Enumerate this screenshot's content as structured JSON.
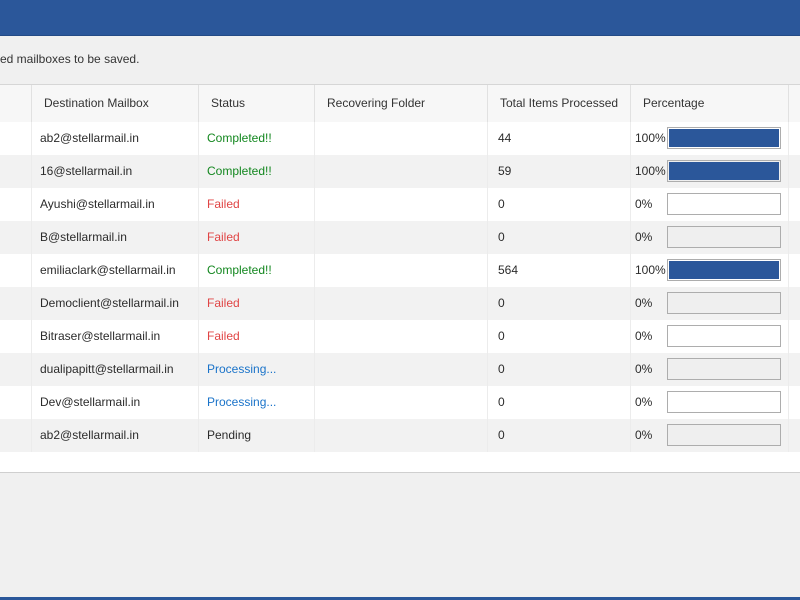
{
  "info_text": "ed mailboxes to be saved.",
  "colors": {
    "titlebar": "#2b579a",
    "completed": "#13871f",
    "failed": "#e04545",
    "processing": "#1a73c9",
    "pending": "#2b2b2b",
    "progress_fill": "#2b579a"
  },
  "columns": [
    "Destination Mailbox",
    "Status",
    "Recovering Folder",
    "Total Items Processed",
    "Percentage"
  ],
  "rows": [
    {
      "mailbox": "ab2@stellarmail.in",
      "status": "Completed!!",
      "status_kind": "completed",
      "folder": "",
      "items": "44",
      "percentage": "100%",
      "progress": 1.0
    },
    {
      "mailbox": "16@stellarmail.in",
      "status": "Completed!!",
      "status_kind": "completed",
      "folder": "",
      "items": "59",
      "percentage": "100%",
      "progress": 1.0
    },
    {
      "mailbox": "Ayushi@stellarmail.in",
      "status": "Failed",
      "status_kind": "failed",
      "folder": "",
      "items": "0",
      "percentage": "0%",
      "progress": 0
    },
    {
      "mailbox": "B@stellarmail.in",
      "status": "Failed",
      "status_kind": "failed",
      "folder": "",
      "items": "0",
      "percentage": "0%",
      "progress": 0
    },
    {
      "mailbox": "emiliaclark@stellarmail.in",
      "status": "Completed!!",
      "status_kind": "completed",
      "folder": "",
      "items": "564",
      "percentage": "100%",
      "progress": 1.0
    },
    {
      "mailbox": "Democlient@stellarmail.in",
      "status": "Failed",
      "status_kind": "failed",
      "folder": "",
      "items": "0",
      "percentage": "0%",
      "progress": 0
    },
    {
      "mailbox": "Bitraser@stellarmail.in",
      "status": "Failed",
      "status_kind": "failed",
      "folder": "",
      "items": "0",
      "percentage": "0%",
      "progress": 0
    },
    {
      "mailbox": "dualipapitt@stellarmail.in",
      "status": "Processing...",
      "status_kind": "processing",
      "folder": "",
      "items": "0",
      "percentage": "0%",
      "progress": 0
    },
    {
      "mailbox": "Dev@stellarmail.in",
      "status": "Processing...",
      "status_kind": "processing",
      "folder": "",
      "items": "0",
      "percentage": "0%",
      "progress": 0
    },
    {
      "mailbox": "ab2@stellarmail.in",
      "status": "Pending",
      "status_kind": "pending",
      "folder": "",
      "items": "0",
      "percentage": "0%",
      "progress": 0
    }
  ]
}
